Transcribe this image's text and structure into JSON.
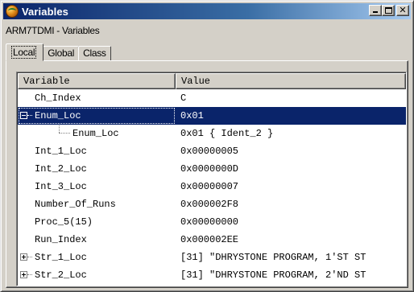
{
  "window": {
    "title": "Variables",
    "subtitle": "ARM7TDMI - Variables"
  },
  "tabs": [
    {
      "label": "Local",
      "active": true
    },
    {
      "label": "Global",
      "active": false
    },
    {
      "label": "Class",
      "active": false
    }
  ],
  "table": {
    "columns": [
      "Variable",
      "Value"
    ],
    "rows": [
      {
        "name": "Ch_Index",
        "value": "C"
      },
      {
        "name": "Enum_Loc",
        "value": "0x01",
        "expander": "minus",
        "selected": true
      },
      {
        "name": "Enum_Loc",
        "value": "0x01 { Ident_2 }",
        "child": true
      },
      {
        "name": "Int_1_Loc",
        "value": "0x00000005"
      },
      {
        "name": "Int_2_Loc",
        "value": "0x0000000D"
      },
      {
        "name": "Int_3_Loc",
        "value": "0x00000007"
      },
      {
        "name": "Number_Of_Runs",
        "value": "0x000002F8"
      },
      {
        "name": "Proc_5(15)",
        "value": "0x00000000"
      },
      {
        "name": "Run_Index",
        "value": "0x000002EE"
      },
      {
        "name": "Str_1_Loc",
        "value": "[31] \"DHRYSTONE PROGRAM, 1'ST ST",
        "expander": "plus"
      },
      {
        "name": "Str_2_Loc",
        "value": "[31] \"DHRYSTONE PROGRAM, 2'ND ST",
        "expander": "plus"
      }
    ]
  },
  "colors": {
    "title_active": "#0a246a",
    "selection": "#0a246a",
    "face": "#d4d0c8"
  },
  "icons": {
    "app": "globe-icon",
    "minimize": "minimize-icon",
    "maximize": "maximize-icon",
    "close": "close-icon"
  }
}
